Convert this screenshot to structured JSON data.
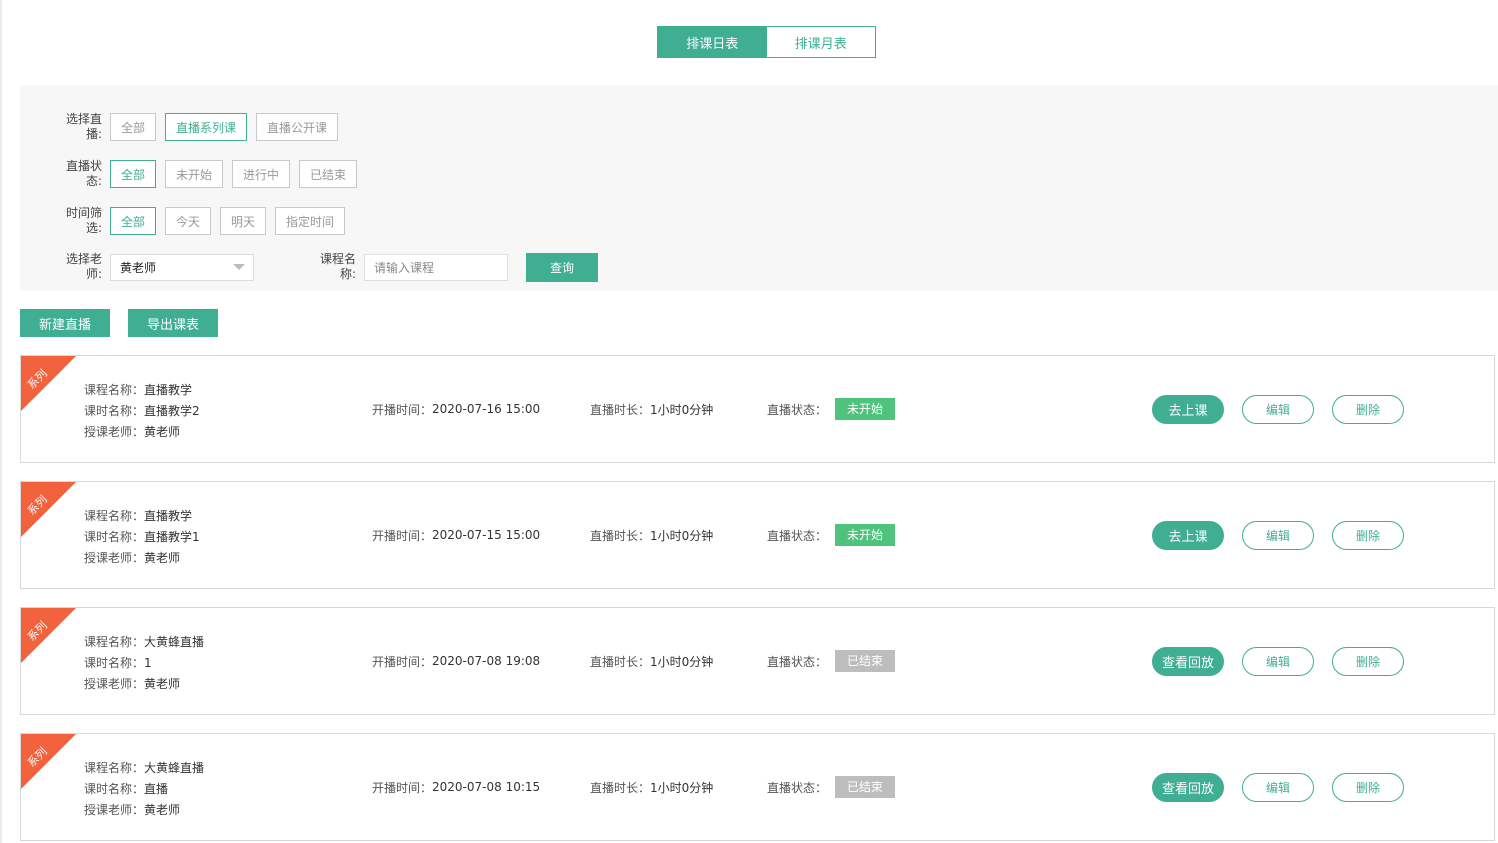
{
  "tabs": [
    {
      "label": "排课日表",
      "active": true
    },
    {
      "label": "排课月表",
      "active": false
    }
  ],
  "filters": {
    "live_type": {
      "label": [
        "选择直",
        "播:"
      ],
      "options": [
        "全部",
        "直播系列课",
        "直播公开课"
      ],
      "selected": "直播系列课"
    },
    "live_status": {
      "label": [
        "直播状",
        "态:"
      ],
      "options": [
        "全部",
        "未开始",
        "进行中",
        "已结束"
      ],
      "selected": "全部"
    },
    "time": {
      "label": [
        "时间筛",
        "选:"
      ],
      "options": [
        "全部",
        "今天",
        "明天",
        "指定时间"
      ],
      "selected": "全部"
    },
    "teacher": {
      "label": [
        "选择老",
        "师:"
      ],
      "value": "黄老师"
    },
    "course": {
      "label": [
        "课程名",
        "称:"
      ],
      "placeholder": "请输入课程"
    },
    "query_label": "查询"
  },
  "actions": {
    "new_live": "新建直播",
    "export": "导出课表"
  },
  "labels": {
    "course_name": "课程名称：",
    "lesson_name": "课时名称：",
    "teacher": "授课老师：",
    "start_time": "开播时间：",
    "duration": "直播时长：",
    "status": "直播状态：",
    "edit": "编辑",
    "delete": "删除",
    "ribbon": "系列"
  },
  "colors": {
    "primary": "#3fae93",
    "ribbon": "#f2623d",
    "status_pending": "#4fc27e",
    "status_ended": "#bdbdbd"
  },
  "lessons": [
    {
      "course": "直播教学",
      "lesson": "直播教学2",
      "teacher": "黄老师",
      "start": "2020-07-16 15:00",
      "duration": "1小时0分钟",
      "status": "未开始",
      "status_type": "pending",
      "action": "去上课"
    },
    {
      "course": "直播教学",
      "lesson": "直播教学1",
      "teacher": "黄老师",
      "start": "2020-07-15 15:00",
      "duration": "1小时0分钟",
      "status": "未开始",
      "status_type": "pending",
      "action": "去上课"
    },
    {
      "course": "大黄蜂直播",
      "lesson": "1",
      "teacher": "黄老师",
      "start": "2020-07-08 19:08",
      "duration": "1小时0分钟",
      "status": "已结束",
      "status_type": "ended",
      "action": "查看回放"
    },
    {
      "course": "大黄蜂直播",
      "lesson": "直播",
      "teacher": "黄老师",
      "start": "2020-07-08 10:15",
      "duration": "1小时0分钟",
      "status": "已结束",
      "status_type": "ended",
      "action": "查看回放"
    }
  ]
}
